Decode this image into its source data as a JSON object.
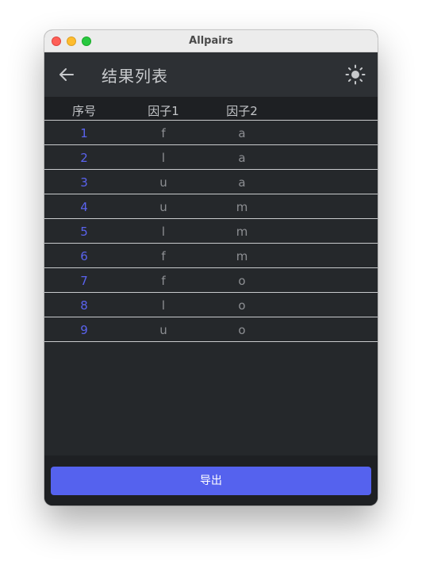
{
  "window": {
    "title": "Allpairs"
  },
  "appbar": {
    "title": "结果列表",
    "back_icon": "arrow-left-icon",
    "theme_icon": "sun-icon"
  },
  "table": {
    "headers": [
      "序号",
      "因子1",
      "因子2"
    ],
    "rows": [
      [
        "1",
        "f",
        "a"
      ],
      [
        "2",
        "l",
        "a"
      ],
      [
        "3",
        "u",
        "a"
      ],
      [
        "4",
        "u",
        "m"
      ],
      [
        "5",
        "l",
        "m"
      ],
      [
        "6",
        "f",
        "m"
      ],
      [
        "7",
        "f",
        "o"
      ],
      [
        "8",
        "l",
        "o"
      ],
      [
        "9",
        "u",
        "o"
      ]
    ]
  },
  "footer": {
    "export_label": "导出"
  },
  "colors": {
    "accent": "#5562ee",
    "index_text": "#5a63ee",
    "background": "#25282b"
  }
}
